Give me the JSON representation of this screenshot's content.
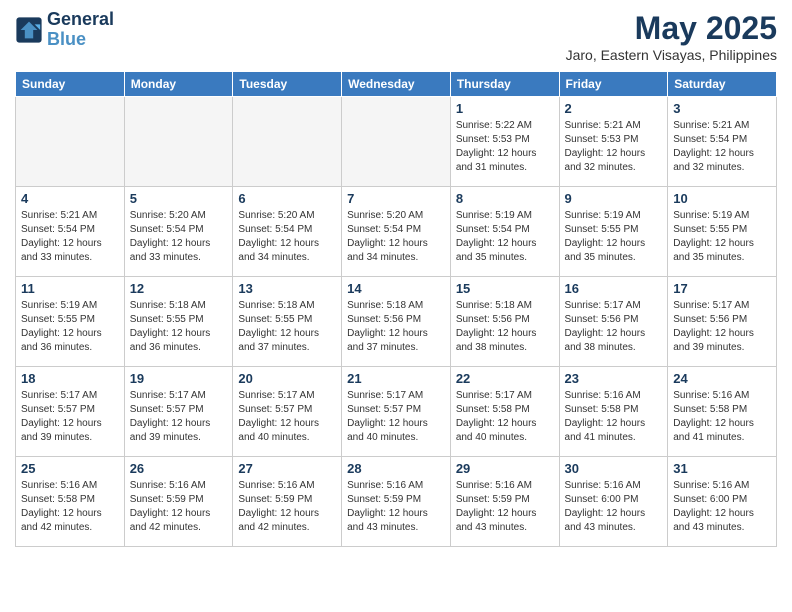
{
  "header": {
    "logo_line1": "General",
    "logo_line2": "Blue",
    "title": "May 2025",
    "subtitle": "Jaro, Eastern Visayas, Philippines"
  },
  "days_of_week": [
    "Sunday",
    "Monday",
    "Tuesday",
    "Wednesday",
    "Thursday",
    "Friday",
    "Saturday"
  ],
  "weeks": [
    [
      {
        "day": "",
        "info": ""
      },
      {
        "day": "",
        "info": ""
      },
      {
        "day": "",
        "info": ""
      },
      {
        "day": "",
        "info": ""
      },
      {
        "day": "1",
        "info": "Sunrise: 5:22 AM\nSunset: 5:53 PM\nDaylight: 12 hours\nand 31 minutes."
      },
      {
        "day": "2",
        "info": "Sunrise: 5:21 AM\nSunset: 5:53 PM\nDaylight: 12 hours\nand 32 minutes."
      },
      {
        "day": "3",
        "info": "Sunrise: 5:21 AM\nSunset: 5:54 PM\nDaylight: 12 hours\nand 32 minutes."
      }
    ],
    [
      {
        "day": "4",
        "info": "Sunrise: 5:21 AM\nSunset: 5:54 PM\nDaylight: 12 hours\nand 33 minutes."
      },
      {
        "day": "5",
        "info": "Sunrise: 5:20 AM\nSunset: 5:54 PM\nDaylight: 12 hours\nand 33 minutes."
      },
      {
        "day": "6",
        "info": "Sunrise: 5:20 AM\nSunset: 5:54 PM\nDaylight: 12 hours\nand 34 minutes."
      },
      {
        "day": "7",
        "info": "Sunrise: 5:20 AM\nSunset: 5:54 PM\nDaylight: 12 hours\nand 34 minutes."
      },
      {
        "day": "8",
        "info": "Sunrise: 5:19 AM\nSunset: 5:54 PM\nDaylight: 12 hours\nand 35 minutes."
      },
      {
        "day": "9",
        "info": "Sunrise: 5:19 AM\nSunset: 5:55 PM\nDaylight: 12 hours\nand 35 minutes."
      },
      {
        "day": "10",
        "info": "Sunrise: 5:19 AM\nSunset: 5:55 PM\nDaylight: 12 hours\nand 35 minutes."
      }
    ],
    [
      {
        "day": "11",
        "info": "Sunrise: 5:19 AM\nSunset: 5:55 PM\nDaylight: 12 hours\nand 36 minutes."
      },
      {
        "day": "12",
        "info": "Sunrise: 5:18 AM\nSunset: 5:55 PM\nDaylight: 12 hours\nand 36 minutes."
      },
      {
        "day": "13",
        "info": "Sunrise: 5:18 AM\nSunset: 5:55 PM\nDaylight: 12 hours\nand 37 minutes."
      },
      {
        "day": "14",
        "info": "Sunrise: 5:18 AM\nSunset: 5:56 PM\nDaylight: 12 hours\nand 37 minutes."
      },
      {
        "day": "15",
        "info": "Sunrise: 5:18 AM\nSunset: 5:56 PM\nDaylight: 12 hours\nand 38 minutes."
      },
      {
        "day": "16",
        "info": "Sunrise: 5:17 AM\nSunset: 5:56 PM\nDaylight: 12 hours\nand 38 minutes."
      },
      {
        "day": "17",
        "info": "Sunrise: 5:17 AM\nSunset: 5:56 PM\nDaylight: 12 hours\nand 39 minutes."
      }
    ],
    [
      {
        "day": "18",
        "info": "Sunrise: 5:17 AM\nSunset: 5:57 PM\nDaylight: 12 hours\nand 39 minutes."
      },
      {
        "day": "19",
        "info": "Sunrise: 5:17 AM\nSunset: 5:57 PM\nDaylight: 12 hours\nand 39 minutes."
      },
      {
        "day": "20",
        "info": "Sunrise: 5:17 AM\nSunset: 5:57 PM\nDaylight: 12 hours\nand 40 minutes."
      },
      {
        "day": "21",
        "info": "Sunrise: 5:17 AM\nSunset: 5:57 PM\nDaylight: 12 hours\nand 40 minutes."
      },
      {
        "day": "22",
        "info": "Sunrise: 5:17 AM\nSunset: 5:58 PM\nDaylight: 12 hours\nand 40 minutes."
      },
      {
        "day": "23",
        "info": "Sunrise: 5:16 AM\nSunset: 5:58 PM\nDaylight: 12 hours\nand 41 minutes."
      },
      {
        "day": "24",
        "info": "Sunrise: 5:16 AM\nSunset: 5:58 PM\nDaylight: 12 hours\nand 41 minutes."
      }
    ],
    [
      {
        "day": "25",
        "info": "Sunrise: 5:16 AM\nSunset: 5:58 PM\nDaylight: 12 hours\nand 42 minutes."
      },
      {
        "day": "26",
        "info": "Sunrise: 5:16 AM\nSunset: 5:59 PM\nDaylight: 12 hours\nand 42 minutes."
      },
      {
        "day": "27",
        "info": "Sunrise: 5:16 AM\nSunset: 5:59 PM\nDaylight: 12 hours\nand 42 minutes."
      },
      {
        "day": "28",
        "info": "Sunrise: 5:16 AM\nSunset: 5:59 PM\nDaylight: 12 hours\nand 43 minutes."
      },
      {
        "day": "29",
        "info": "Sunrise: 5:16 AM\nSunset: 5:59 PM\nDaylight: 12 hours\nand 43 minutes."
      },
      {
        "day": "30",
        "info": "Sunrise: 5:16 AM\nSunset: 6:00 PM\nDaylight: 12 hours\nand 43 minutes."
      },
      {
        "day": "31",
        "info": "Sunrise: 5:16 AM\nSunset: 6:00 PM\nDaylight: 12 hours\nand 43 minutes."
      }
    ]
  ]
}
